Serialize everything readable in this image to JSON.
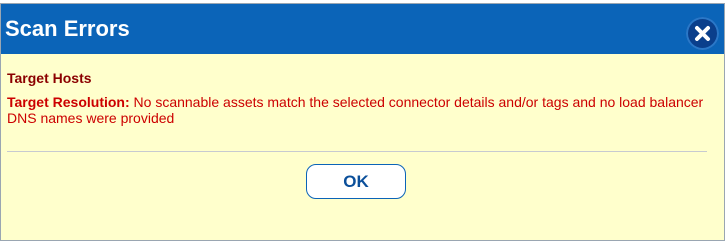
{
  "dialog": {
    "title": "Scan Errors",
    "close_icon": "close-x-icon",
    "section_heading": "Target Hosts",
    "error_label": "Target Resolution:",
    "error_message": " No scannable assets match the selected connector details and/or tags and no load balancer DNS names were provided",
    "ok_label": "OK"
  },
  "colors": {
    "title_bar": "#0b64b8",
    "body_bg": "#ffffcc",
    "heading": "#8b0000",
    "error_text": "#cc0000"
  }
}
